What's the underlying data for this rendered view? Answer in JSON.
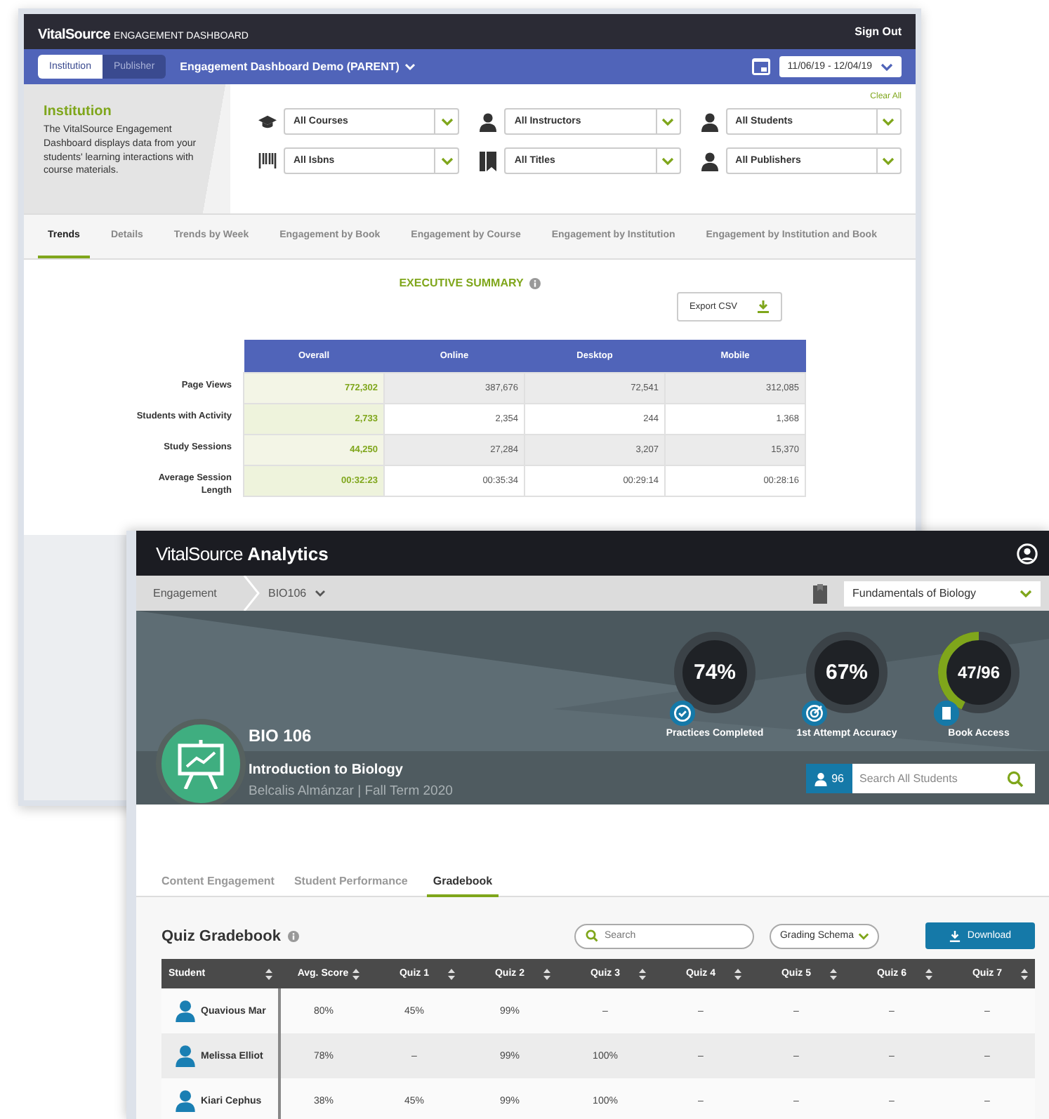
{
  "dashboard_window": {
    "logo": {
      "brand": "VitalSource",
      "product": "ENGAGEMENT DASHBOARD"
    },
    "sign_out": "Sign Out",
    "view_toggle": [
      {
        "label": "Institution",
        "selected": true
      },
      {
        "label": "Publisher",
        "selected": false
      }
    ],
    "report_title": "Engagement Dashboard Demo (PARENT)",
    "date_range": "11/06/19 - 12/04/19",
    "info_panel": {
      "title": "Institution",
      "description": "The VitalSource Engagement Dashboard displays data from your students' learning interactions with course materials."
    },
    "clear_all": "Clear All",
    "filters": [
      {
        "kind": "courses",
        "value": "All Courses"
      },
      {
        "kind": "person",
        "value": "All Instructors"
      },
      {
        "kind": "person",
        "value": "All Students"
      },
      {
        "kind": "isbn",
        "value": "All Isbns"
      },
      {
        "kind": "book",
        "value": "All Titles"
      },
      {
        "kind": "person",
        "value": "All Publishers"
      }
    ],
    "tabs": [
      {
        "label": "Trends",
        "selected": true
      },
      {
        "label": "Details",
        "selected": false
      },
      {
        "label": "Trends by Week",
        "selected": false
      },
      {
        "label": "Engagement by Book",
        "selected": false
      },
      {
        "label": "Engagement by Course",
        "selected": false
      },
      {
        "label": "Engagement by Institution",
        "selected": false
      },
      {
        "label": "Engagement by Institution and Book",
        "selected": false
      }
    ],
    "summary_title": "EXECUTIVE SUMMARY",
    "export_button": "Export CSV",
    "summary_table": {
      "columns": [
        "Overall",
        "Online",
        "Desktop",
        "Mobile"
      ],
      "rows": [
        {
          "label": "Page Views",
          "values": [
            "772,302",
            "387,676",
            "72,541",
            "312,085"
          ]
        },
        {
          "label": "Students with Activity",
          "values": [
            "2,733",
            "2,354",
            "244",
            "1,368"
          ]
        },
        {
          "label": "Study Sessions",
          "values": [
            "44,250",
            "27,284",
            "3,207",
            "15,370"
          ]
        },
        {
          "label": "Average Session Length",
          "values": [
            "00:32:23",
            "00:35:34",
            "00:29:14",
            "00:28:16"
          ]
        }
      ]
    }
  },
  "analytics_window": {
    "logo": {
      "brand": "VitalSource",
      "product": "Analytics"
    },
    "breadcrumb": [
      "Engagement",
      "BIO106"
    ],
    "book_select": "Fundamentals of Biology",
    "course": {
      "code": "BIO 106",
      "name": "Introduction to Biology",
      "details": "Belcalis Almánzar  |  Fall Term 2020"
    },
    "metrics": [
      {
        "kind": "check",
        "value": "74%",
        "label": "Practices Completed"
      },
      {
        "kind": "target",
        "value": "67%",
        "label": "1st Attempt Accuracy"
      },
      {
        "kind": "book",
        "value": "47/96",
        "label": "Book Access",
        "level": 0.43
      }
    ],
    "student_count": "96",
    "student_search": {
      "placeholder": "Search All Students"
    },
    "tabs": [
      {
        "label": "Content Engagement",
        "selected": false
      },
      {
        "label": "Student Performance",
        "selected": false
      },
      {
        "label": "Gradebook",
        "selected": true
      }
    ],
    "gradebook_title": "Quiz Gradebook",
    "search": {
      "placeholder": "Search"
    },
    "grading_schema": "Grading Schema",
    "download_button": "Download",
    "table": {
      "columns": [
        "Student",
        "Avg. Score",
        "Quiz 1",
        "Quiz 2",
        "Quiz 3",
        "Quiz 4",
        "Quiz 5",
        "Quiz 6",
        "Quiz 7"
      ],
      "rows": [
        {
          "cells": [
            "Quavious Mar",
            "80%",
            "45%",
            "99%",
            "–",
            "–",
            "–",
            "–",
            "–"
          ]
        },
        {
          "cells": [
            "Melissa Elliot",
            "78%",
            "–",
            "99%",
            "100%",
            "–",
            "–",
            "–",
            "–"
          ]
        },
        {
          "cells": [
            "Kiari Cephus",
            "38%",
            "45%",
            "99%",
            "100%",
            "–",
            "–",
            "–",
            "–"
          ]
        }
      ]
    }
  }
}
